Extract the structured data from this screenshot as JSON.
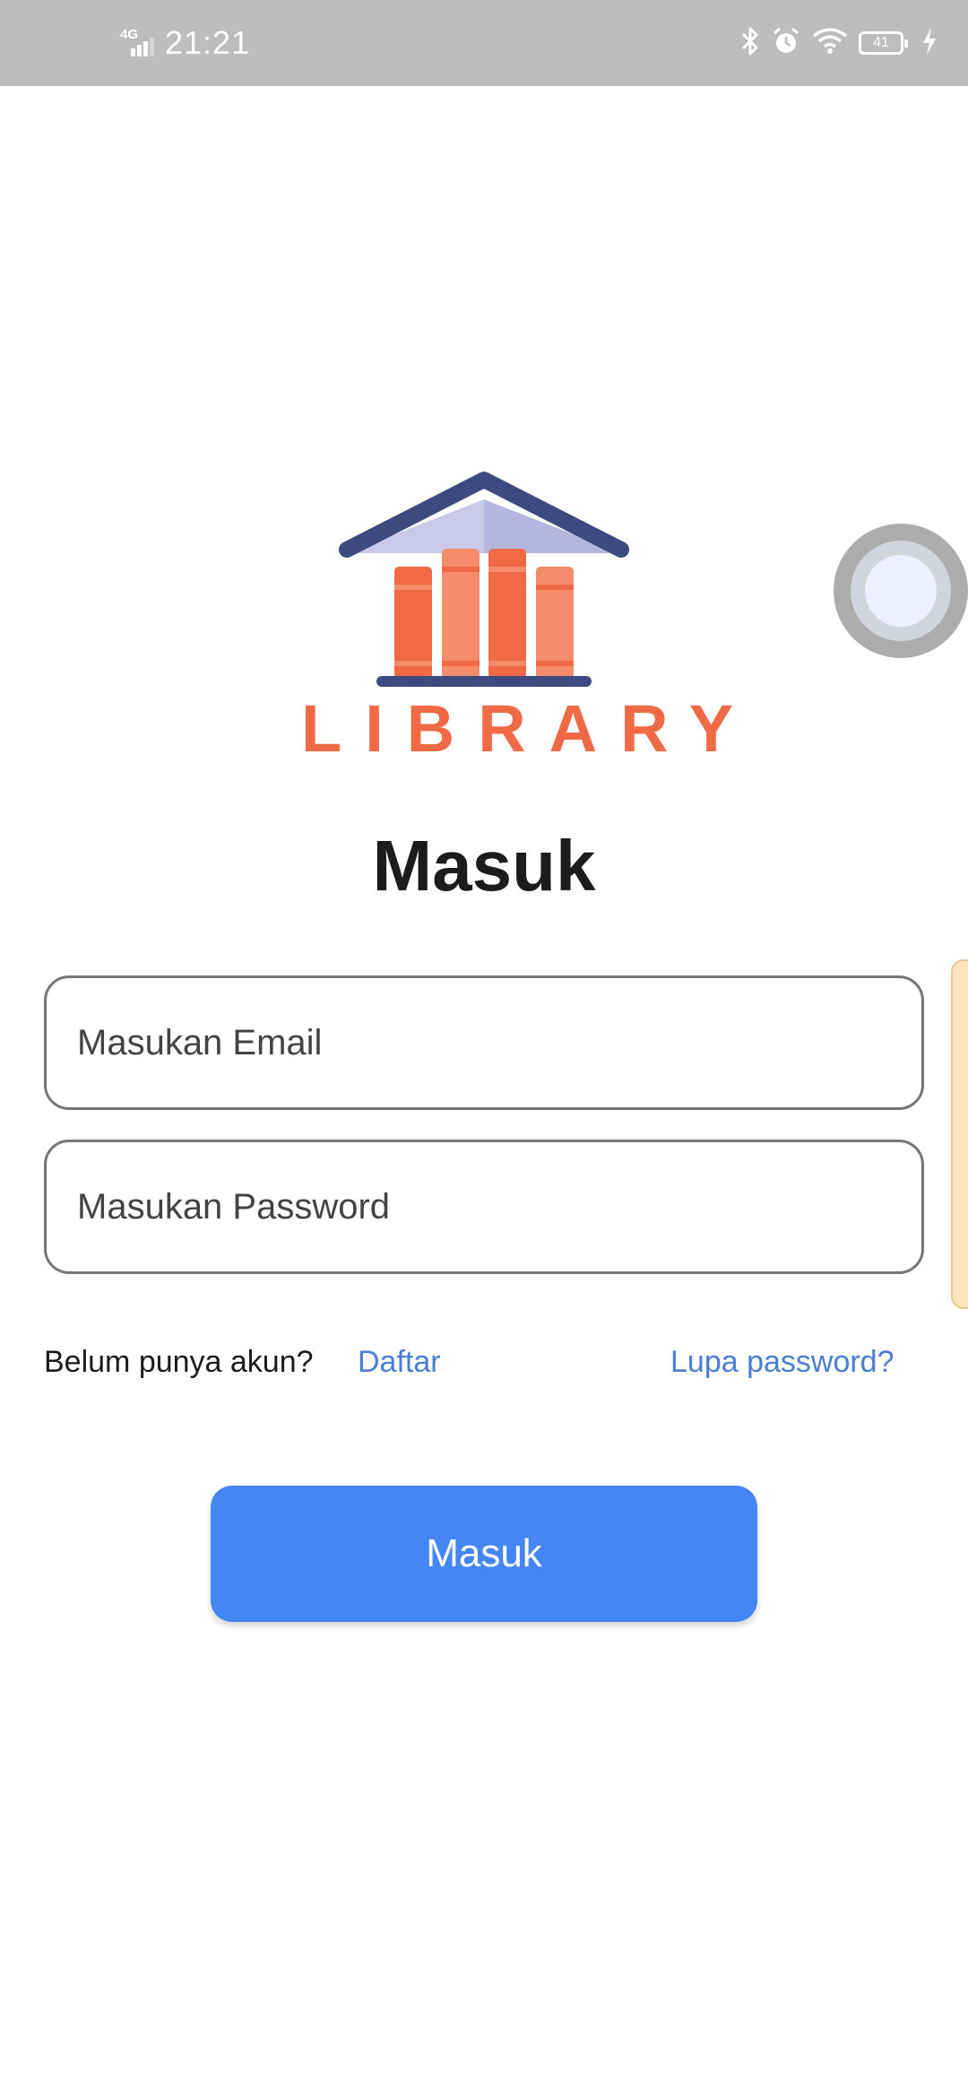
{
  "status_bar": {
    "network": "4G",
    "time": "21:21",
    "battery": "41",
    "icons": [
      "signal-icon",
      "bluetooth-icon",
      "alarm-icon",
      "wifi-icon",
      "battery-icon",
      "charging-icon"
    ]
  },
  "logo": {
    "text": "LIBRARY",
    "colors": {
      "roof": "#3d4a80",
      "roof_inner": "#c9c9ea",
      "book_dark": "#f06a45",
      "book_light": "#f48c6c",
      "shelf": "#3d4a80"
    }
  },
  "login": {
    "title": "Masuk",
    "email_placeholder": "Masukan Email",
    "password_placeholder": "Masukan Password",
    "no_account_text": "Belum punya akun?",
    "register_link": "Daftar",
    "forgot_link": "Lupa password?",
    "submit_label": "Masuk"
  },
  "colors": {
    "accent": "#4486f4",
    "link": "#4a7fd4",
    "status_bar": "#bdbdbd"
  }
}
